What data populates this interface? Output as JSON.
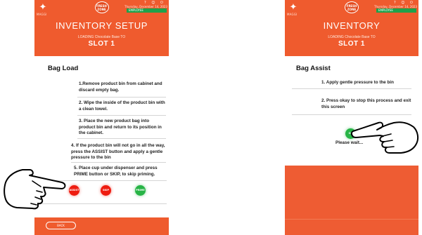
{
  "header": {
    "app_tag": "MAGGI",
    "brand_logo_text": "FRESH ZONE",
    "status_icons": "? ☺ ⏻",
    "datetime": "Thursday, December 14, 2023",
    "employee_badge": "EMPLOYEE"
  },
  "left_screen": {
    "title": "INVENTORY SETUP",
    "subtitle": "LOADING Chocolate Base TO",
    "slot": "SLOT 1",
    "panel_heading": "Bag Load",
    "steps": [
      "1.Remove product bin from cabinet and discard empty bag.",
      "2. Wipe the inside of the product bin with a clean towel.",
      "3. Place the new product bag into product bin and return to its position in the cabinet.",
      "4. If the product bin will not go in all the way, press the ASSIST button and apply a gentle pressure to the bin",
      "5. Place cup under dispenser and press PRIME button or SKIP, to skip priming."
    ],
    "buttons": {
      "assist": "ASSIST",
      "skip": "SKIP",
      "prime": "PRIME"
    },
    "back_label": "BACK"
  },
  "right_screen": {
    "title": "INVENTORY",
    "subtitle": "LOADING Chocolate Base TO",
    "slot": "SLOT 1",
    "panel_heading": "Bag Assist",
    "steps": [
      "1. Apply gentle pressure to the bin",
      "2. Press okay to stop this process and exit this screen"
    ],
    "ok_label": "OK",
    "wait_text": "Please wait..."
  },
  "colors": {
    "brand_orange": "#ef5b2e",
    "red_button": "#ee1c10",
    "green_button": "#27b446",
    "employee_green": "#1fa14b"
  }
}
